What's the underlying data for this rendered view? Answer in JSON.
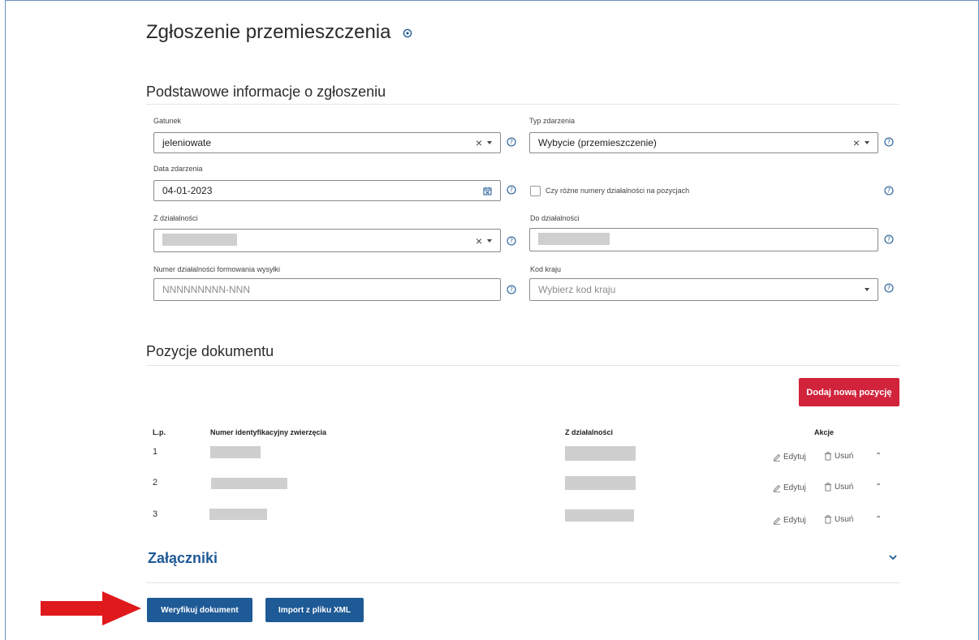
{
  "page": {
    "title": "Zgłoszenie przemieszczenia"
  },
  "basic_section": {
    "title": "Podstawowe informacje o zgłoszeniu",
    "gatunek": {
      "label": "Gatunek",
      "value": "jeleniowate"
    },
    "typ_zdarzenia": {
      "label": "Typ zdarzenia",
      "value": "Wybycie (przemieszczenie)"
    },
    "data_zdarzenia": {
      "label": "Data zdarzenia",
      "value": "04-01-2023"
    },
    "rozne_numery": {
      "label": "Czy różne numery działalności na pozycjach",
      "checked": false
    },
    "z_dzialalnosci": {
      "label": "Z działalności"
    },
    "do_dzialalnosci": {
      "label": "Do działalności"
    },
    "numer_formowania": {
      "label": "Numer działalności formowania wysyłki",
      "placeholder": "NNNNNNNNN-NNN"
    },
    "kod_kraju": {
      "label": "Kod kraju",
      "placeholder": "Wybierz kod kraju"
    }
  },
  "positions_section": {
    "title": "Pozycje dokumentu",
    "add_button": "Dodaj nową pozycję",
    "columns": {
      "lp": "L.p.",
      "numer": "Numer identyfikacyjny zwierzęcia",
      "z_dzialalnosci": "Z działalności",
      "akcje": "Akcje"
    },
    "rows": [
      {
        "lp": "1"
      },
      {
        "lp": "2"
      },
      {
        "lp": "3"
      }
    ],
    "edit_label": "Edytuj",
    "delete_label": "Usuń"
  },
  "attachments": {
    "title": "Załączniki"
  },
  "footer": {
    "verify_button": "Weryfikuj dokument",
    "import_button": "Import z pliku XML"
  },
  "colors": {
    "accent_blue": "#1e5a96",
    "accent_red": "#d1233b",
    "annotation_arrow": "#e0191c"
  }
}
